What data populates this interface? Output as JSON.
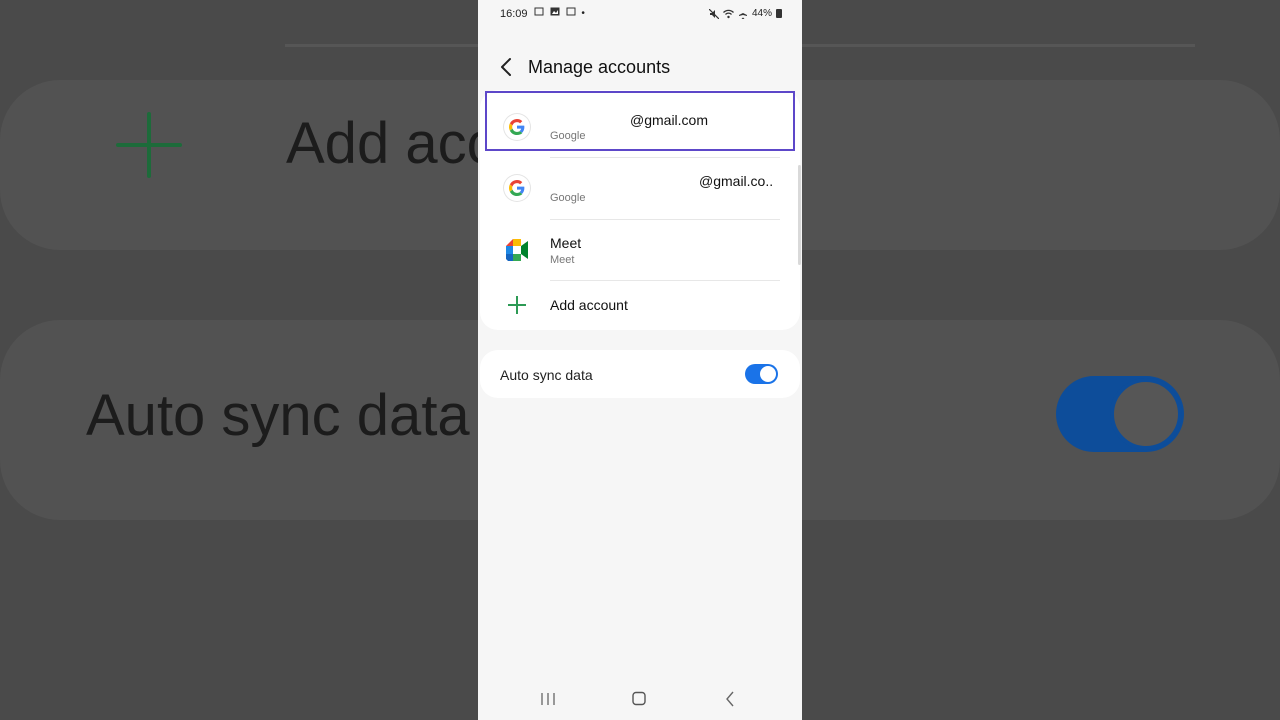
{
  "backdrop": {
    "add_account_text": "Add acc",
    "auto_sync_text": "Auto sync data"
  },
  "status_bar": {
    "time": "16:09",
    "battery": "44%"
  },
  "header": {
    "title": "Manage accounts"
  },
  "accounts": [
    {
      "email": "@gmail.com",
      "provider": "Google",
      "icon": "google-icon",
      "selected": true
    },
    {
      "email": "@gmail.co..",
      "provider": "Google",
      "icon": "google-icon",
      "selected": false
    },
    {
      "email": "Meet",
      "provider": "Meet",
      "icon": "meet-icon",
      "selected": false
    }
  ],
  "add_account": {
    "label": "Add account",
    "icon": "plus-icon"
  },
  "auto_sync": {
    "label": "Auto sync data",
    "enabled": true
  },
  "colors": {
    "accent": "#1a73e8",
    "selection_outline": "#5d47c9",
    "add_green": "#2d9a55"
  }
}
